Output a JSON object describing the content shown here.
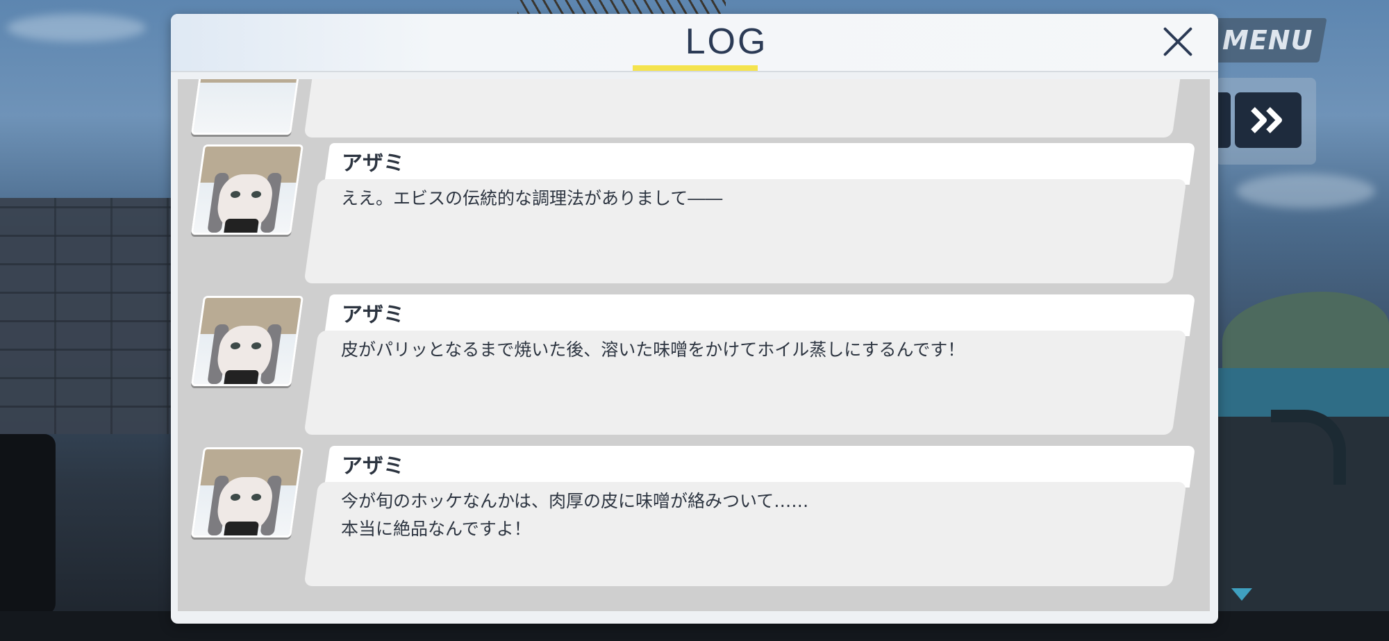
{
  "menu": {
    "label": "MENU"
  },
  "controls": {
    "fast_forward_icon": "double-chevron-right"
  },
  "log": {
    "title": "LOG",
    "partial_entry": {
      "text": "…"
    },
    "entries": [
      {
        "speaker": "アザミ",
        "text": "ええ。エビスの伝統的な調理法がありまして――"
      },
      {
        "speaker": "アザミ",
        "text": "皮がパリッとなるまで焼いた後、溶いた味噌をかけてホイル蒸しにするんです！"
      },
      {
        "speaker": "アザミ",
        "text": "今が旬のホッケなんかは、肉厚の皮に味噌が絡みついて……\n本当に絶品なんですよ！"
      }
    ]
  },
  "colors": {
    "title": "#2b3a55",
    "underline": "#f4e34e",
    "ff_button": "#1e2b3d"
  }
}
